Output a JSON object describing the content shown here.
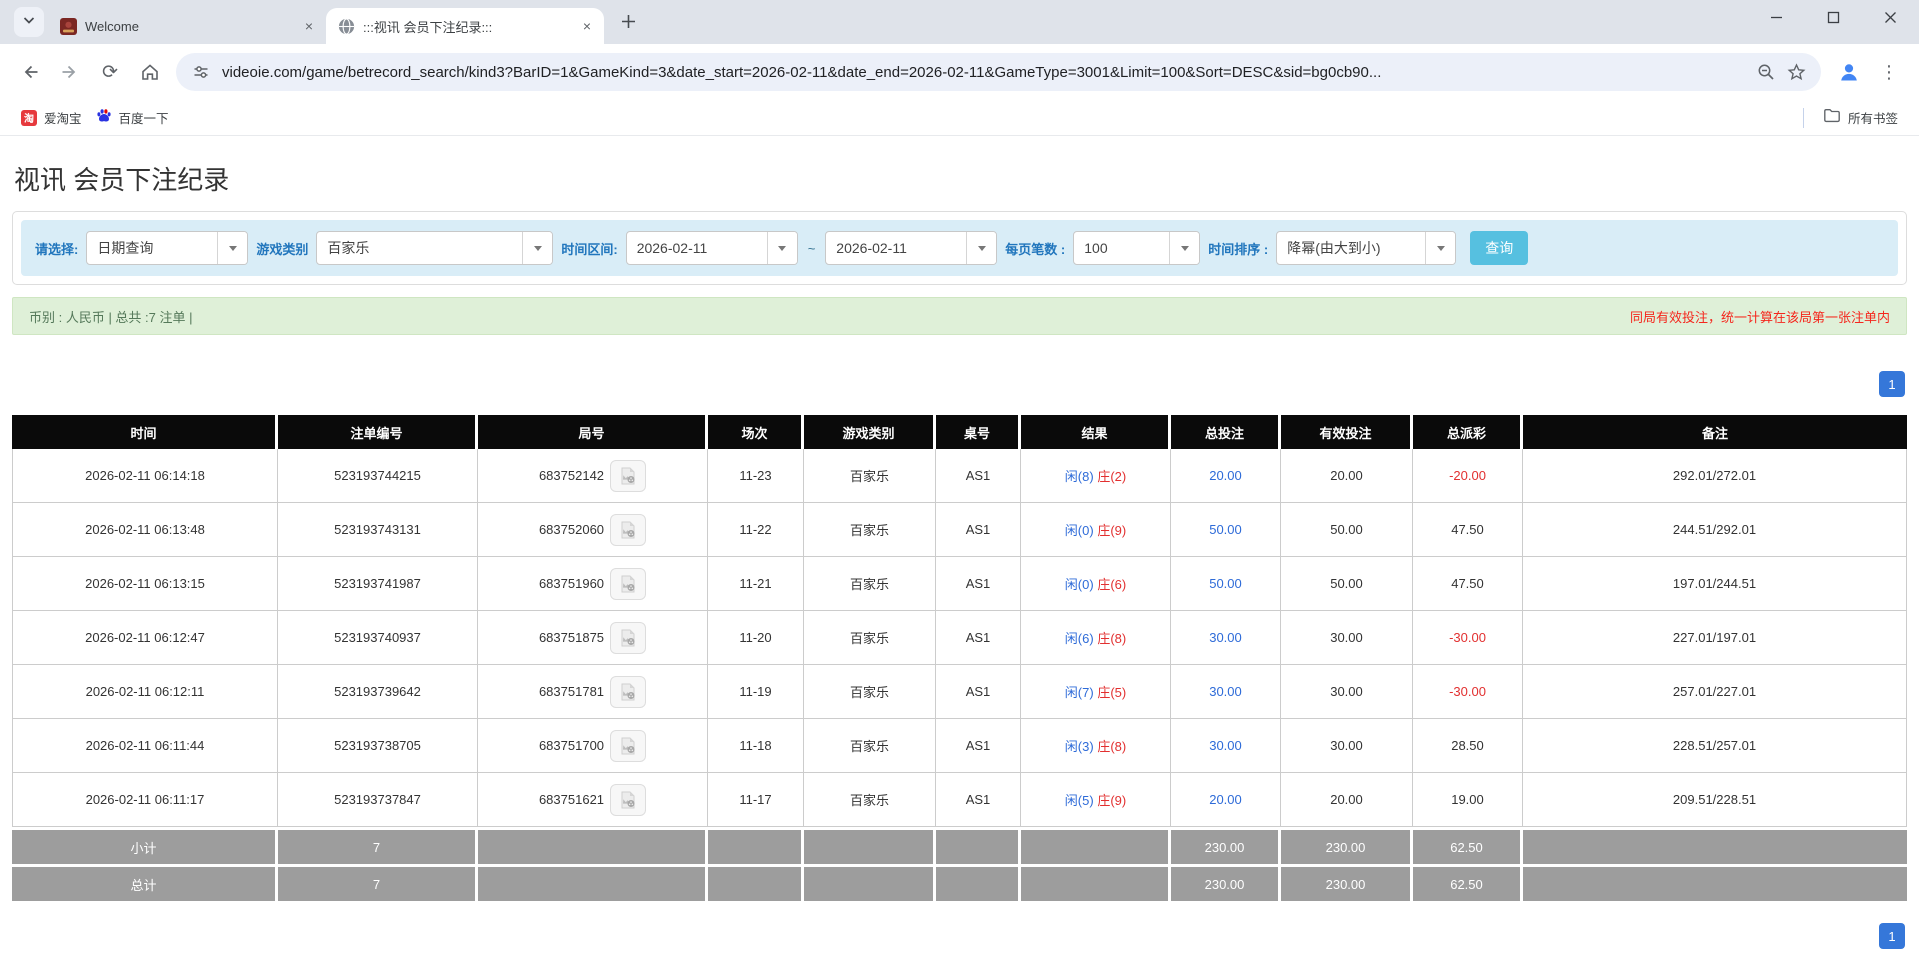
{
  "browser": {
    "tabs": [
      {
        "title": "Welcome"
      },
      {
        "title": ":::视讯 会员下注纪录:::"
      }
    ],
    "url": "videoie.com/game/betrecord_search/kind3?BarID=1&GameKind=3&date_start=2026-02-11&date_end=2026-02-11&GameType=3001&Limit=100&Sort=DESC&sid=bg0cb90...",
    "bookmarks": [
      {
        "label": "爱淘宝",
        "badge": "淘"
      },
      {
        "label": "百度一下"
      }
    ],
    "all_bookmarks_label": "所有书签"
  },
  "page": {
    "title": "视讯 会员下注纪录",
    "filters": {
      "select_label": "请选择:",
      "select_value": "日期查询",
      "game_kind_label": "游戏类别",
      "game_kind_value": "百家乐",
      "range_label": "时间区间:",
      "date_start": "2026-02-11",
      "tilde": "~",
      "date_end": "2026-02-11",
      "per_page_label": "每页笔数 :",
      "per_page_value": "100",
      "sort_label": "时间排序 :",
      "sort_value": "降幂(由大到小)",
      "search_button": "查询"
    },
    "summary": {
      "left": "币别 : 人民币 | 总共 :7 注单 |",
      "right": "同局有效投注，统一计算在该局第一张注单内"
    },
    "pagination": {
      "page": "1"
    },
    "table": {
      "headers": [
        "时间",
        "注单编号",
        "局号",
        "场次",
        "游戏类别",
        "桌号",
        "结果",
        "总投注",
        "有效投注",
        "总派彩",
        "备注"
      ],
      "rows": [
        {
          "time": "2026-02-11 06:14:18",
          "bet_id": "523193744215",
          "round_id": "683752142",
          "session": "11-23",
          "game": "百家乐",
          "table_no": "AS1",
          "result_player": "闲(8)",
          "result_banker": "庄(2)",
          "total_bet": "20.00",
          "valid_bet": "20.00",
          "payout": "-20.00",
          "note": "292.01/272.01"
        },
        {
          "time": "2026-02-11 06:13:48",
          "bet_id": "523193743131",
          "round_id": "683752060",
          "session": "11-22",
          "game": "百家乐",
          "table_no": "AS1",
          "result_player": "闲(0)",
          "result_banker": "庄(9)",
          "total_bet": "50.00",
          "valid_bet": "50.00",
          "payout": "47.50",
          "note": "244.51/292.01"
        },
        {
          "time": "2026-02-11 06:13:15",
          "bet_id": "523193741987",
          "round_id": "683751960",
          "session": "11-21",
          "game": "百家乐",
          "table_no": "AS1",
          "result_player": "闲(0)",
          "result_banker": "庄(6)",
          "total_bet": "50.00",
          "valid_bet": "50.00",
          "payout": "47.50",
          "note": "197.01/244.51"
        },
        {
          "time": "2026-02-11 06:12:47",
          "bet_id": "523193740937",
          "round_id": "683751875",
          "session": "11-20",
          "game": "百家乐",
          "table_no": "AS1",
          "result_player": "闲(6)",
          "result_banker": "庄(8)",
          "total_bet": "30.00",
          "valid_bet": "30.00",
          "payout": "-30.00",
          "note": "227.01/197.01"
        },
        {
          "time": "2026-02-11 06:12:11",
          "bet_id": "523193739642",
          "round_id": "683751781",
          "session": "11-19",
          "game": "百家乐",
          "table_no": "AS1",
          "result_player": "闲(7)",
          "result_banker": "庄(5)",
          "total_bet": "30.00",
          "valid_bet": "30.00",
          "payout": "-30.00",
          "note": "257.01/227.01"
        },
        {
          "time": "2026-02-11 06:11:44",
          "bet_id": "523193738705",
          "round_id": "683751700",
          "session": "11-18",
          "game": "百家乐",
          "table_no": "AS1",
          "result_player": "闲(3)",
          "result_banker": "庄(8)",
          "total_bet": "30.00",
          "valid_bet": "30.00",
          "payout": "28.50",
          "note": "228.51/257.01"
        },
        {
          "time": "2026-02-11 06:11:17",
          "bet_id": "523193737847",
          "round_id": "683751621",
          "session": "11-17",
          "game": "百家乐",
          "table_no": "AS1",
          "result_player": "闲(5)",
          "result_banker": "庄(9)",
          "total_bet": "20.00",
          "valid_bet": "20.00",
          "payout": "19.00",
          "note": "209.51/228.51"
        }
      ],
      "subtotal": {
        "label": "小计",
        "count": "7",
        "total_bet": "230.00",
        "valid_bet": "230.00",
        "payout": "62.50"
      },
      "total": {
        "label": "总计",
        "count": "7",
        "total_bet": "230.00",
        "valid_bet": "230.00",
        "payout": "62.50"
      }
    },
    "colors": {
      "table_header_bg": "#0a0a0a",
      "table_footer_bg": "#9d9d9d",
      "bet_blue": "#2e6bd8",
      "loss_red": "#e23030",
      "filter_panel_bg": "#d9edf7",
      "filter_label_blue": "#2176bd",
      "search_button_bg": "#56c0e0",
      "summary_bg": "#dff0d8",
      "summary_text_green": "#55795a",
      "notice_red": "#f5271d",
      "pagination_blue": "#3577d9"
    }
  }
}
